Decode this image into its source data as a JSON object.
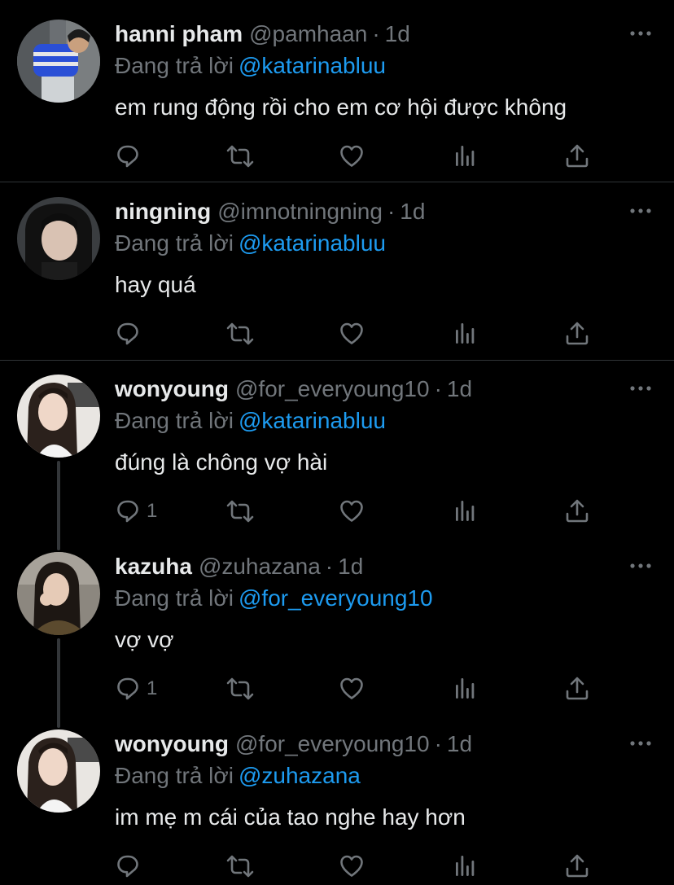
{
  "colors": {
    "background": "#000000",
    "text": "#e7e9ea",
    "muted": "#71767b",
    "link": "#1d9bf0",
    "divider": "#2f3336"
  },
  "reply_prefix": "Đang trả lời",
  "tweets": [
    {
      "name": "hanni pham",
      "handle": "@pamhaan",
      "time": "1d",
      "reply_to": "@katarinabluu",
      "text": "em rung động rồi cho em cơ hội được không",
      "reply_count": ""
    },
    {
      "name": "ningning",
      "handle": "@imnotningning",
      "time": "1d",
      "reply_to": "@katarinabluu",
      "text": "hay quá",
      "reply_count": ""
    },
    {
      "name": "wonyoung",
      "handle": "@for_everyoung10",
      "time": "1d",
      "reply_to": "@katarinabluu",
      "text": "đúng là chông vợ hài",
      "reply_count": "1"
    },
    {
      "name": "kazuha",
      "handle": "@zuhazana",
      "time": "1d",
      "reply_to": "@for_everyoung10",
      "text": "vợ vợ",
      "reply_count": "1"
    },
    {
      "name": "wonyoung",
      "handle": "@for_everyoung10",
      "time": "1d",
      "reply_to": "@zuhazana",
      "text": "im mẹ m cái của tao nghe hay hơn",
      "reply_count": ""
    }
  ],
  "dot_separator": "·"
}
